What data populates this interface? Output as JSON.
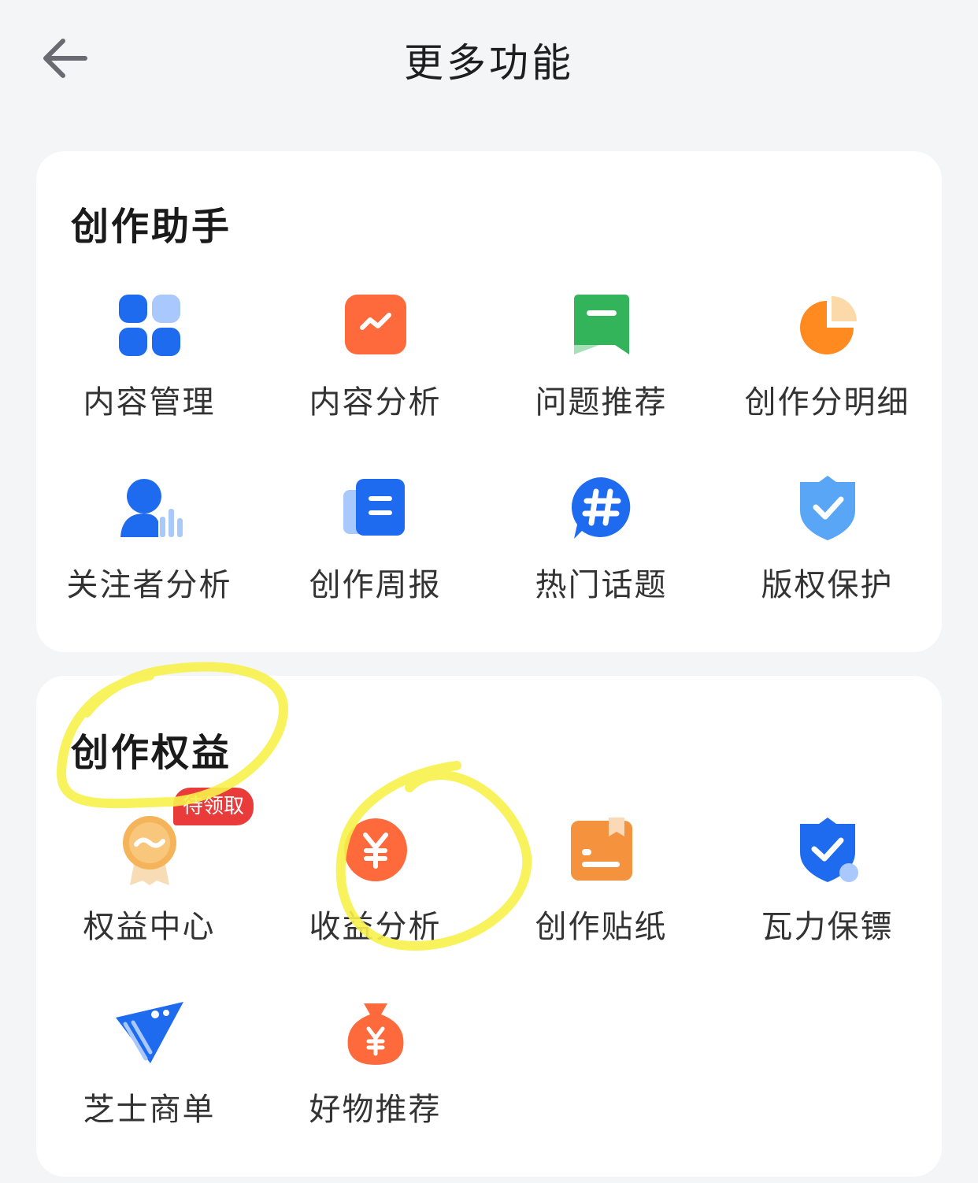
{
  "header": {
    "title": "更多功能"
  },
  "sections": [
    {
      "title": "创作助手",
      "items": [
        {
          "label": "内容管理",
          "icon": "content-manage-icon"
        },
        {
          "label": "内容分析",
          "icon": "content-analysis-icon"
        },
        {
          "label": "问题推荐",
          "icon": "question-recommend-icon"
        },
        {
          "label": "创作分明细",
          "icon": "score-detail-icon"
        },
        {
          "label": "关注者分析",
          "icon": "follower-analysis-icon"
        },
        {
          "label": "创作周报",
          "icon": "weekly-report-icon"
        },
        {
          "label": "热门话题",
          "icon": "hot-topic-icon"
        },
        {
          "label": "版权保护",
          "icon": "copyright-icon"
        }
      ]
    },
    {
      "title": "创作权益",
      "items": [
        {
          "label": "权益中心",
          "icon": "rights-center-icon",
          "badge": "待领取"
        },
        {
          "label": "收益分析",
          "icon": "income-analysis-icon"
        },
        {
          "label": "创作贴纸",
          "icon": "sticker-icon"
        },
        {
          "label": "瓦力保镖",
          "icon": "bodyguard-icon"
        },
        {
          "label": "芝士商单",
          "icon": "cheese-order-icon"
        },
        {
          "label": "好物推荐",
          "icon": "goods-recommend-icon"
        }
      ]
    }
  ],
  "colors": {
    "background": "#f4f5f7",
    "card": "#ffffff",
    "blue": "#1e6bf0",
    "orange": "#ff6a3d",
    "green": "#33b35a",
    "badge": "#ea3b3b",
    "highlighter": "#f7f24a"
  }
}
